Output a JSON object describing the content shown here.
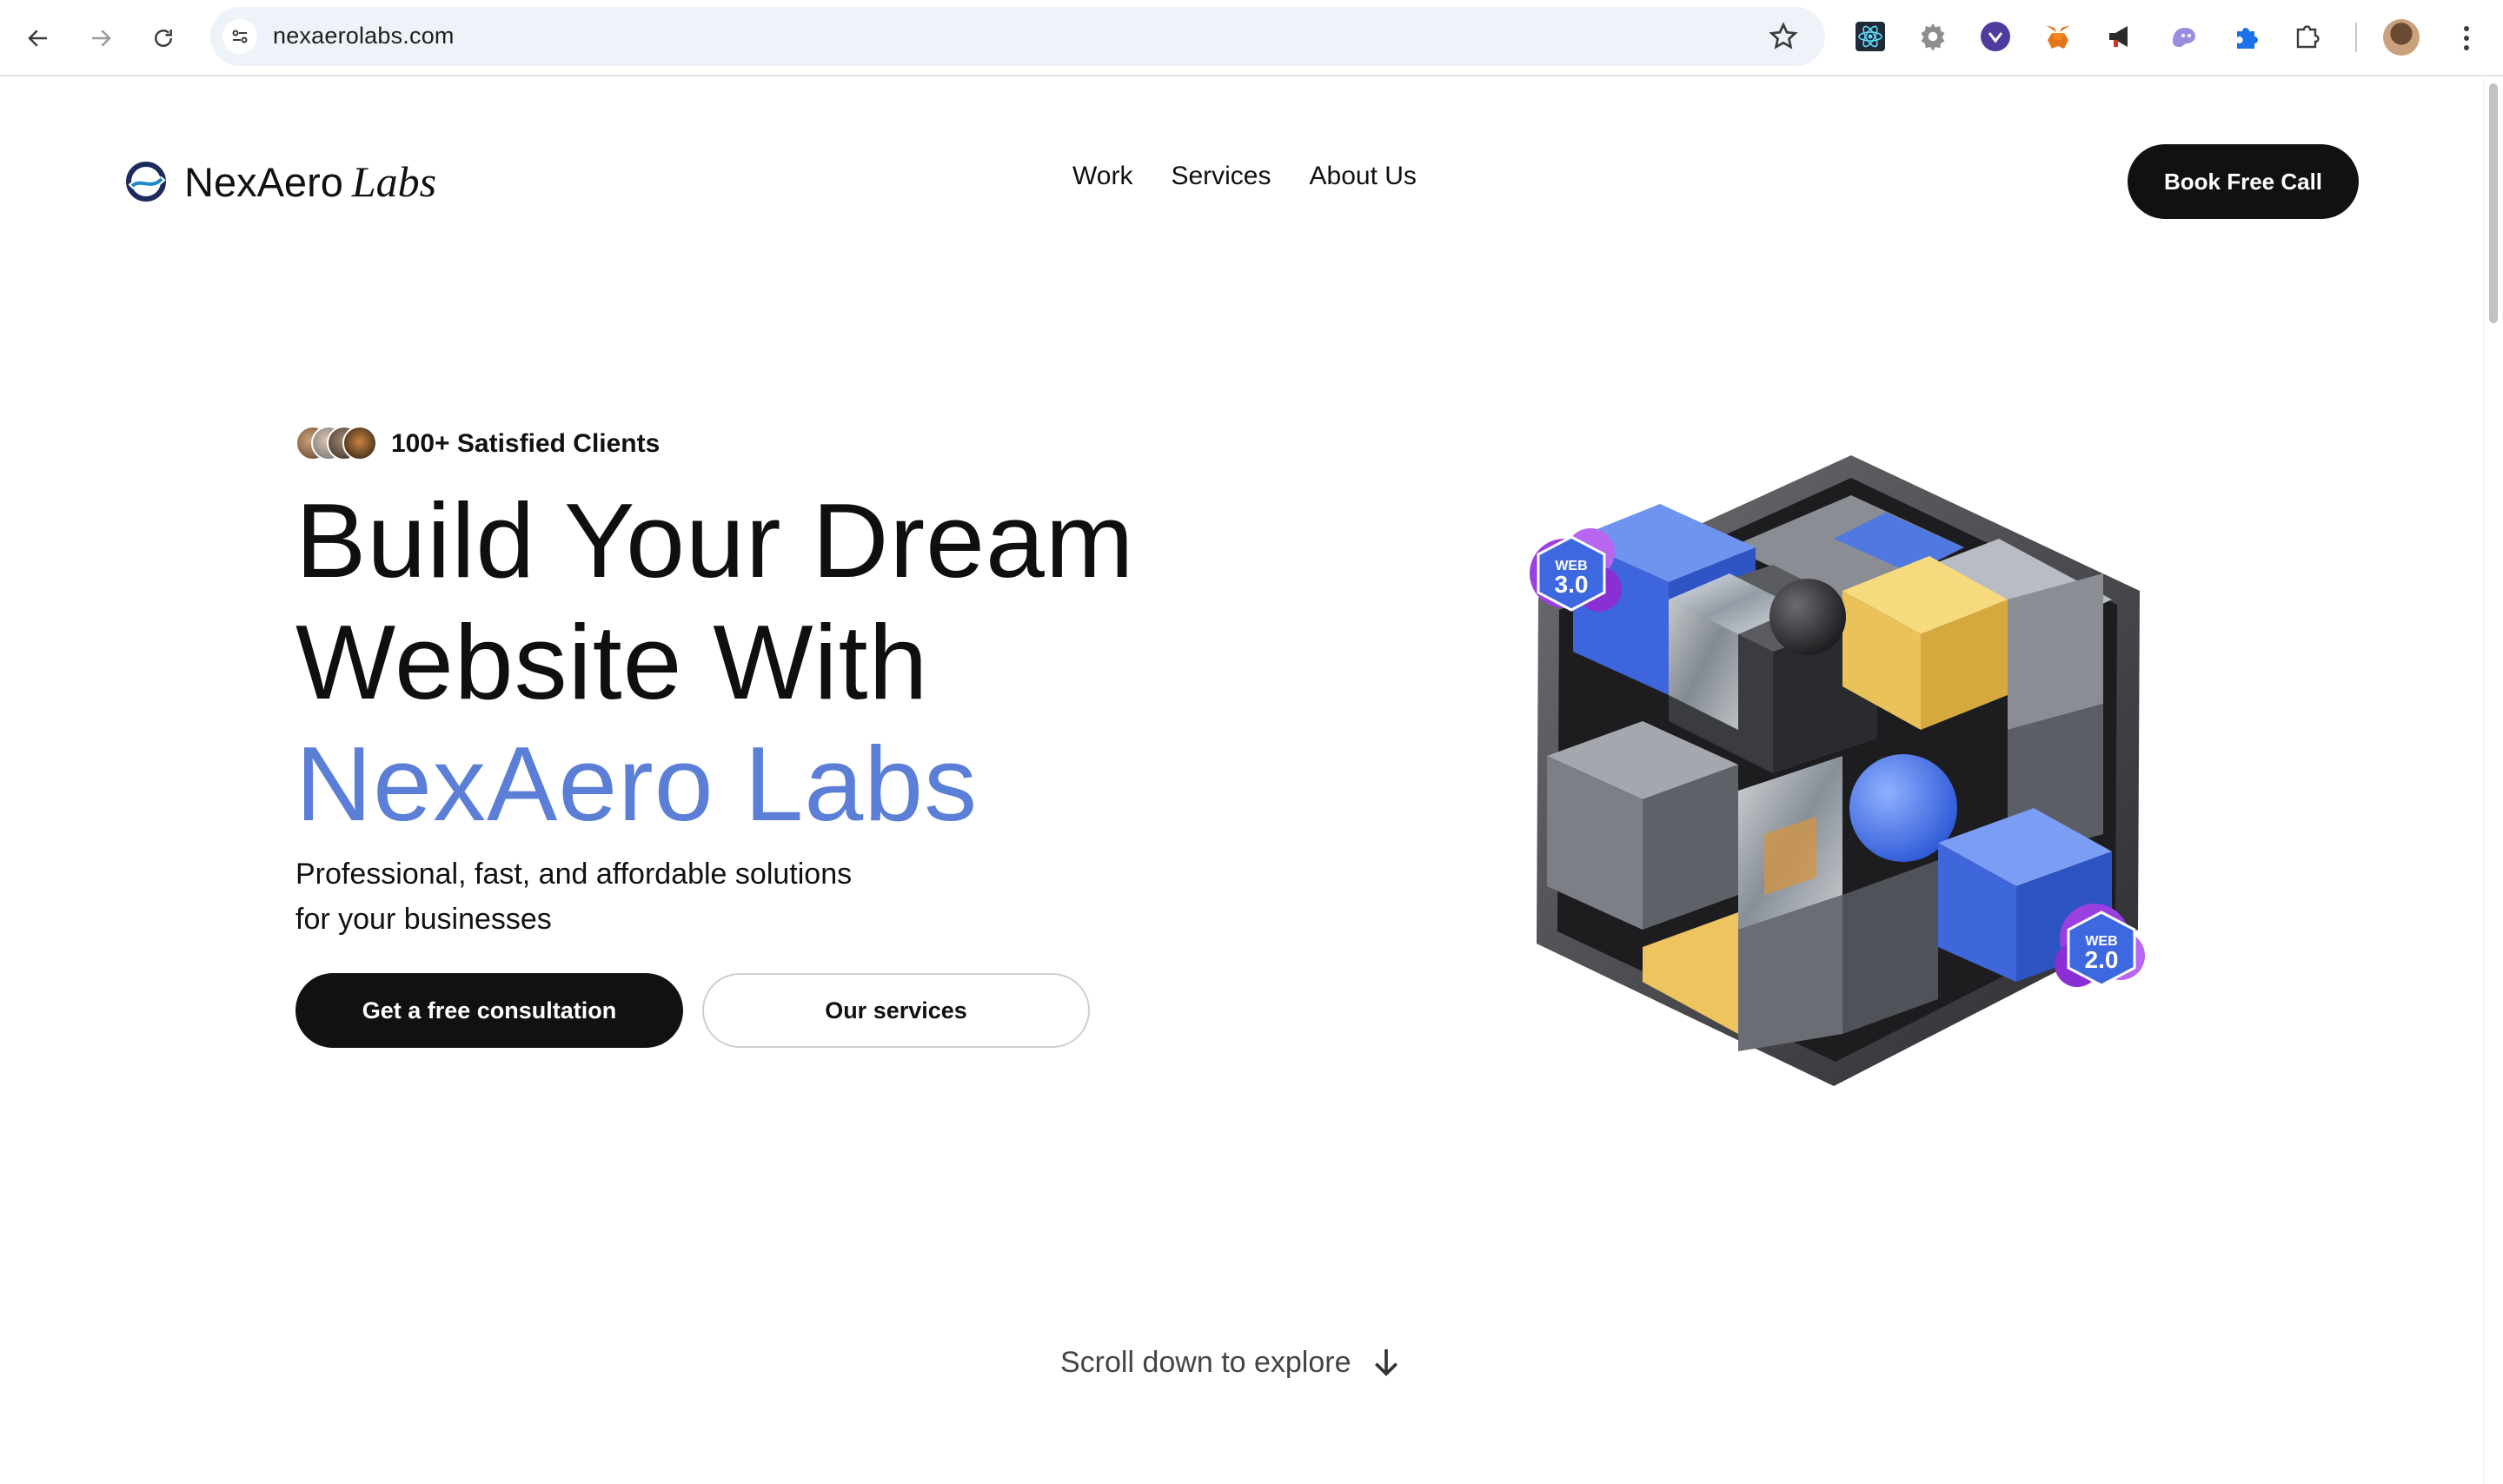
{
  "browser": {
    "url": "nexaerolabs.com",
    "extensions": [
      "react-devtools-icon",
      "settings-gear-icon",
      "vimeo-icon",
      "metamask-fox-icon",
      "megaphone-icon",
      "ghost-icon",
      "puzzle-icon"
    ]
  },
  "header": {
    "logo_name": "NexAero",
    "logo_suffix": "Labs",
    "nav": [
      "Work",
      "Services",
      "About Us"
    ],
    "cta": "Book Free Call"
  },
  "hero": {
    "clients": "100+ Satisfied Clients",
    "headline_line1": "Build Your Dream",
    "headline_line2": "Website With",
    "headline_accent": "NexAero Labs",
    "subtitle_line1": "Professional, fast, and affordable solutions",
    "subtitle_line2": "for your businesses",
    "primary_button": "Get a free consultation",
    "secondary_button": "Our services",
    "badge_top_line1": "WEB",
    "badge_top_line2": "3.0",
    "badge_bottom_line1": "WEB",
    "badge_bottom_line2": "2.0"
  },
  "scroll_hint": "Scroll down to explore",
  "colors": {
    "accent": "#5b7fd6",
    "button_dark": "#111111",
    "omnibox": "#eef2f9"
  }
}
